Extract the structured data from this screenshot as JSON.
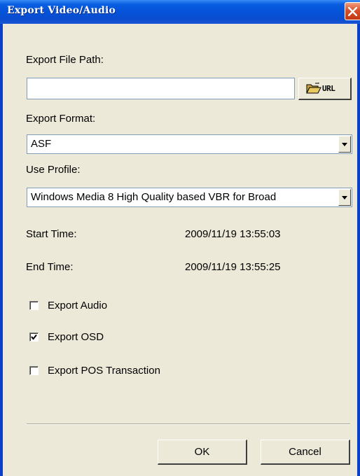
{
  "window": {
    "title": "Export Video/Audio"
  },
  "file_path": {
    "label": "Export File Path:",
    "value": "",
    "browse_text": "URL"
  },
  "format": {
    "label": "Export Format:",
    "selected": "ASF"
  },
  "profile": {
    "label": "Use Profile:",
    "selected": "Windows Media 8 High Quality based VBR for Broad"
  },
  "times": {
    "start_label": "Start Time:",
    "start_value": "2009/11/19 13:55:03",
    "end_label": "End Time:",
    "end_value": "2009/11/19 13:55:25"
  },
  "options": [
    {
      "label": "Export Audio",
      "checked": false
    },
    {
      "label": "Export OSD",
      "checked": true
    },
    {
      "label": "Export POS Transaction",
      "checked": false
    }
  ],
  "buttons": {
    "ok": "OK",
    "cancel": "Cancel"
  },
  "icons": {
    "close": "close-icon",
    "browse": "folder-open-icon",
    "dropdown": "chevron-down-icon",
    "check": "checkmark-icon"
  },
  "colors": {
    "titlebar": "#0453d8",
    "face": "#ece9d8",
    "close": "#d8502a"
  }
}
